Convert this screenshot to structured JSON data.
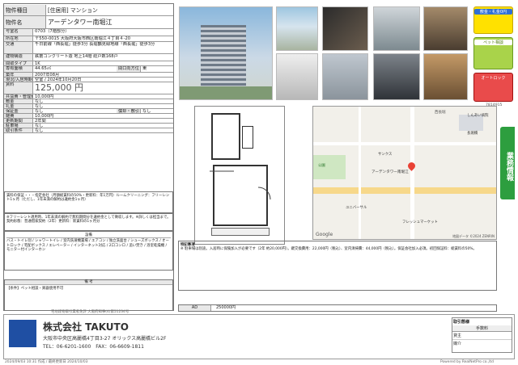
{
  "header": {
    "type_label": "物件種目",
    "type_value": "[住居用] マンション",
    "name_label": "物件名",
    "name_value": "アーデンタワー南堀江"
  },
  "rows": [
    {
      "k": "r_num",
      "label": "号室名",
      "value": "0703（7階部分）"
    },
    {
      "k": "r_addr",
      "label": "所在地",
      "value": "〒550-0015 大阪府大阪市西区南堀江４丁目４-20"
    },
    {
      "k": "r_tr",
      "label": "交通",
      "value": "千日前線「西長堀」徒歩3分 長堀鶴見緑地線「西長堀」徒歩3分"
    },
    {
      "k": "r_bld",
      "label": "建物構造",
      "value": "鉄筋コンクリート造 地上14階 総戸数168戸"
    },
    {
      "k": "r_lay",
      "label": "間取タイプ",
      "value": "1K"
    },
    {
      "k": "r_area",
      "label": "専有面積",
      "value": "44.65㎡",
      "extra_label": "間口向方位",
      "extra_value": "東"
    },
    {
      "k": "r_built",
      "label": "築年",
      "value": "2007年08月"
    },
    {
      "k": "r_move",
      "label": "現況/入居時期",
      "value": "空室 / 2024年10月20日"
    },
    {
      "k": "r_rent",
      "label": "賃料",
      "value": "125,000 円"
    },
    {
      "k": "r_mgmt",
      "label": "共益費・管理費",
      "value": "10,000円"
    },
    {
      "k": "r_deposit",
      "label": "敷金",
      "value": "なし"
    },
    {
      "k": "r_key",
      "label": "礼金",
      "value": "なし"
    },
    {
      "k": "r_hosho",
      "label": "保証金",
      "value": "なし",
      "extra_label": "償却・敷引",
      "extra_value": "なし"
    },
    {
      "k": "r_misc",
      "label": "雑費",
      "value": "10,000円"
    },
    {
      "k": "r_update",
      "label": "更新期間",
      "value": "2年間"
    },
    {
      "k": "r_park",
      "label": "駐車場",
      "value": "なし"
    },
    {
      "k": "r_cond",
      "label": "取引条件",
      "value": "なし"
    }
  ],
  "notes": {
    "text1": "賃料の保証・・・指定会社（月額総賃料の50%・更新料：年1万円）ルームクリーニング：フリーレント1ヶ月（ただし、1年未満の解約は違約金1ヶ月）",
    "text2": "※フリーレント適用時、1年未満の解約で無料期間分を違約金として徴収します。※詳しくは担当まで。契約形態：普通借家契約（2年）更新料：新賃料の1ヶ月分",
    "equip_label": "設備",
    "equip_text": "バス・トイレ別 / シャワートイレ / 室内洗濯機置場 / エアコン / 独立洗面台 / シューズボックス / オートロック / 宅配ボックス / エレベーター / インターネット対応 / 2口コンロ / 追い焚き / 浴室乾燥機 / モニター付インターホン",
    "remark_label": "備 考",
    "remark_text": "【条件】ペット相談・楽器使用不可"
  },
  "side_badges": {
    "b1": "敷金・礼金0円",
    "b2": "ペット相談",
    "b3": "オートロック"
  },
  "map": {
    "title": "西長堀",
    "labels": [
      "アーデンタワー南堀江",
      "サンクス",
      "長堀橋",
      "ユニバーサル",
      "フレッシュマーケット",
      "しんあい病院",
      "公園"
    ],
    "logo": "Google",
    "credit": "地図データ ©2024 ZENRIN"
  },
  "remarks_box": {
    "label": "特記事項",
    "text": "※ 駐車場は別途。入居時に保険加入が必要です（2年 約20,000円）。鍵交換費用：22,000円（税込）、室内清掃費：44,000円（税込）。保証会社加入必須。初回保証料：総賃料の50%。"
  },
  "rent_row": {
    "label": "AD",
    "value": "250000円"
  },
  "footer": {
    "license": "宅地建物取引業者免許 大阪府知事(4)第51234号",
    "company": "株式会社 TAKUTO",
    "address": "大阪市中央区高麗橋4丁目3-27 オリックス高麗橋ビル2F",
    "tel": "TEL：06-6201-1600　FAX：06-6609-1811",
    "fee_title": "取引態様",
    "fee_header": "手数料",
    "fee_rows": [
      "貸主",
      "媒介"
    ],
    "stamp": "2024/09/03 10:31 作成 / 最終更新日 2024/10/03",
    "powered": "Powered by RealNetPro co.,ltd"
  },
  "side_tab": {
    "label": "業務情報"
  },
  "top_num": "7814915"
}
